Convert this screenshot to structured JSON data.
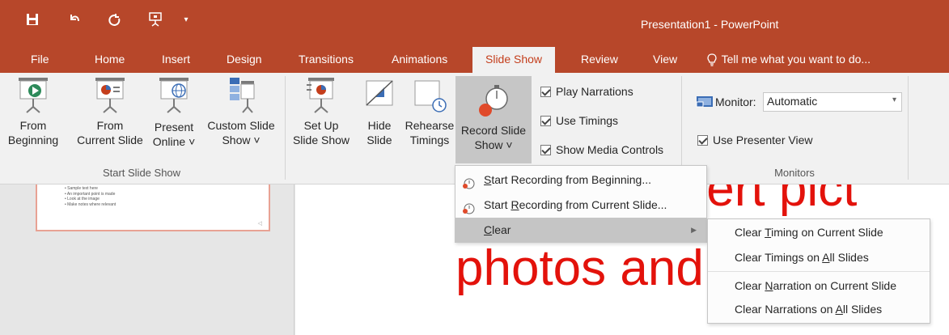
{
  "app": {
    "title": "Presentation1 - PowerPoint",
    "colors": {
      "brand": "#b7472a",
      "ribbon": "#f1f1f1",
      "active_tab_text": "#c43e1c",
      "slide_text": "#e3120b"
    }
  },
  "quick_access": [
    {
      "name": "save-icon",
      "symbol": "🖫"
    },
    {
      "name": "undo-icon",
      "symbol": "↶"
    },
    {
      "name": "redo-icon",
      "symbol": "↻"
    },
    {
      "name": "present-icon",
      "symbol": "⊡"
    },
    {
      "name": "customize-icon",
      "symbol": "⌄"
    }
  ],
  "tabs": [
    {
      "label": "File"
    },
    {
      "label": "Home"
    },
    {
      "label": "Insert"
    },
    {
      "label": "Design"
    },
    {
      "label": "Transitions"
    },
    {
      "label": "Animations"
    },
    {
      "label": "Slide Show",
      "active": true
    },
    {
      "label": "Review"
    },
    {
      "label": "View"
    }
  ],
  "tell_me": "Tell me what you want to do...",
  "ribbon": {
    "start_group": {
      "label": "Start Slide Show",
      "from_beginning": [
        "From",
        "Beginning"
      ],
      "from_current": [
        "From",
        "Current Slide"
      ],
      "present_online": [
        "Present",
        "Online ˅"
      ],
      "custom_show": [
        "Custom Slide",
        "Show ˅"
      ]
    },
    "setup_group": {
      "setup": [
        "Set Up",
        "Slide Show"
      ],
      "hide": [
        "Hide",
        "Slide"
      ],
      "rehearse": [
        "Rehearse",
        "Timings"
      ],
      "record": [
        "Record Slide",
        "Show ˅"
      ],
      "play_narrations": "Play Narrations",
      "use_timings": "Use Timings",
      "show_media_controls": "Show Media Controls"
    },
    "monitors_group": {
      "label": "Monitors",
      "monitor_label": "Monitor:",
      "monitor_value": "Automatic",
      "use_presenter_view": "Use Presenter View"
    }
  },
  "record_menu": {
    "items": [
      {
        "pre": "",
        "u": "S",
        "post": "tart Recording from Beginning..."
      },
      {
        "pre": "Start ",
        "u": "R",
        "post": "ecording from Current Slide..."
      },
      {
        "pre": "",
        "u": "C",
        "post": "lear"
      }
    ]
  },
  "clear_submenu": {
    "items": [
      {
        "pre": "Clear ",
        "u": "T",
        "post": "iming on Current Slide"
      },
      {
        "pre": "Clear Timings on ",
        "u": "A",
        "post": "ll Slides"
      },
      {
        "pre": "Clear ",
        "u": "N",
        "post": "arration on Current Slide"
      },
      {
        "pre": "Clear Narrations on ",
        "u": "A",
        "post": "ll Slides"
      }
    ]
  },
  "slide_thumbnail": {
    "bullets": [
      "Sample text here",
      "An important point is made",
      "Look at the image",
      "Make notes where relevant"
    ]
  },
  "slide_canvas": {
    "line1": "You can insert pict",
    "line2": "photos and screensh"
  }
}
